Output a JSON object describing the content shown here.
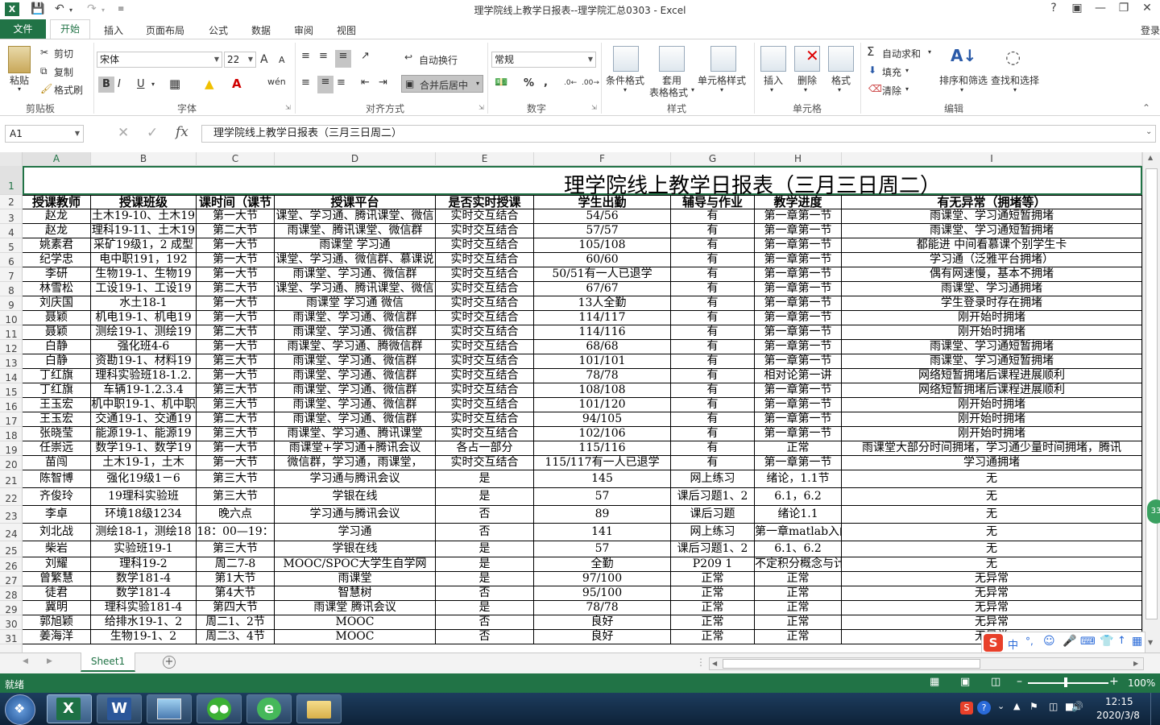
{
  "window": {
    "title": "理学院线上教学日报表--理学院汇总0303 - Excel"
  },
  "quick_access": {
    "save": "save-icon",
    "undo": "undo-icon",
    "redo": "redo-icon"
  },
  "window_controls": {
    "help": "?",
    "restore": "□",
    "minimize": "—",
    "maximize": "❐",
    "close": "✕"
  },
  "tabs": {
    "file": "文件",
    "home": "开始",
    "insert": "插入",
    "page_layout": "页面布局",
    "formulas": "公式",
    "data": "数据",
    "review": "审阅",
    "view": "视图",
    "login": "登录"
  },
  "ribbon": {
    "clipboard": {
      "paste": "粘贴",
      "cut": "剪切",
      "copy": "复制",
      "format_painter": "格式刷",
      "label": "剪贴板"
    },
    "font": {
      "name": "宋体",
      "size": "22",
      "grow": "A",
      "shrink": "A",
      "bold": "B",
      "italic": "I",
      "underline": "U",
      "label": "字体"
    },
    "alignment": {
      "wrap": "自动换行",
      "merge": "合并后居中",
      "label": "对齐方式"
    },
    "number": {
      "format": "常规",
      "percent": "%",
      "comma": ",",
      "label": "数字"
    },
    "styles": {
      "cond_format": "条件格式",
      "table_format_1": "套用",
      "table_format_2": "表格格式",
      "cell_styles": "单元格样式",
      "label": "样式"
    },
    "cells": {
      "insert": "插入",
      "delete": "删除",
      "format": "格式",
      "label": "单元格"
    },
    "editing": {
      "autosum": "自动求和",
      "fill": "填充",
      "clear": "清除",
      "sort": "排序和筛选",
      "find": "查找和选择",
      "label": "编辑"
    }
  },
  "formula_bar": {
    "cell_ref": "A1",
    "fx": "fx",
    "content": "理学院线上教学日报表（三月三日周二）"
  },
  "columns": [
    "A",
    "B",
    "C",
    "D",
    "E",
    "F",
    "G",
    "H",
    "I"
  ],
  "sheet_title": "理学院线上教学日报表（三月三日周二）",
  "headers": [
    "授课教师",
    "授课班级",
    "课时间（课节",
    "授课平台",
    "是否实时授课",
    "学生出勤",
    "辅导与作业",
    "教学进度",
    "有无异常（拥堵等）"
  ],
  "rows": [
    {
      "n": "3",
      "cells": [
        "赵龙",
        "土木19-10、土木19",
        "第一大节",
        "课堂、学习通、腾讯课堂、微信",
        "实时交互结合",
        "54/56",
        "有",
        "第一章第一节",
        "雨课堂、学习通短暂拥堵"
      ]
    },
    {
      "n": "4",
      "cells": [
        "赵龙",
        "理科19-11、土木19",
        "第二大节",
        "雨课堂、腾讯课堂、微信群",
        "实时交互结合",
        "57/57",
        "有",
        "第一章第一节",
        "雨课堂、学习通短暂拥堵"
      ]
    },
    {
      "n": "5",
      "cells": [
        "姚素君",
        "采矿19级1，2 成型",
        "第一大节",
        "雨课堂 学习通",
        "实时交互结合",
        "105/108",
        "有",
        "第一章第一节",
        "都能进 中间看慕课个别学生卡"
      ]
    },
    {
      "n": "6",
      "cells": [
        "纪学忠",
        "电中职191，192",
        "第一大节",
        "课堂、学习通、微信群、慕课说",
        "实时交互结合",
        "60/60",
        "有",
        "第一章第一节",
        "学习通（泛雅平台拥堵）"
      ]
    },
    {
      "n": "7",
      "cells": [
        "李研",
        "生物19-1、生物19",
        "第一大节",
        "雨课堂、学习通、微信群",
        "实时交互结合",
        "50/51有一人已退学",
        "有",
        "第一章第一节",
        "偶有网速慢，基本不拥堵"
      ]
    },
    {
      "n": "8",
      "cells": [
        "林雪松",
        "工设19-1、工设19",
        "第二大节",
        "课堂、学习通、腾讯课堂、微信",
        "实时交互结合",
        "67/67",
        "有",
        "第一章第一节",
        "雨课堂、学习通拥堵"
      ]
    },
    {
      "n": "9",
      "cells": [
        "刘庆国",
        "水土18-1",
        "第一大节",
        "雨课堂 学习通 微信",
        "实时交互结合",
        "13人全勤",
        "有",
        "第一章第一节",
        "学生登录时存在拥堵"
      ]
    },
    {
      "n": "10",
      "cells": [
        "聂颖",
        "机电19-1、机电19",
        "第一大节",
        "雨课堂、学习通、微信群",
        "实时交互结合",
        "114/117",
        "有",
        "第一章第一节",
        "刚开始时拥堵"
      ]
    },
    {
      "n": "11",
      "cells": [
        "聂颖",
        "测绘19-1、测绘19",
        "第二大节",
        "雨课堂、学习通、微信群",
        "实时交互结合",
        "114/116",
        "有",
        "第一章第一节",
        "刚开始时拥堵"
      ]
    },
    {
      "n": "12",
      "cells": [
        "白静",
        "强化班4-6",
        "第一大节",
        "雨课堂、学习通、腾微信群",
        "实时交互结合",
        "68/68",
        "有",
        "第一章第一节",
        "雨课堂、学习通短暂拥堵"
      ]
    },
    {
      "n": "13",
      "cells": [
        "白静",
        "资勘19-1、材料19",
        "第三大节",
        "雨课堂、学习通、微信群",
        "实时交互结合",
        "101/101",
        "有",
        "第一章第一节",
        "雨课堂、学习通短暂拥堵"
      ]
    },
    {
      "n": "14",
      "cells": [
        "丁红旗",
        "理科实验班18-1.2.",
        "第一大节",
        "雨课堂、学习通、微信群",
        "实时交互结合",
        "78/78",
        "有",
        "相对论第一讲",
        "网络短暂拥堵后课程进展顺利"
      ]
    },
    {
      "n": "15",
      "cells": [
        "丁红旗",
        "车辆19-1.2.3.4",
        "第三大节",
        "雨课堂、学习通、微信群",
        "实时交互结合",
        "108/108",
        "有",
        "第一章第一节",
        "网络短暂拥堵后课程进展顺利"
      ]
    },
    {
      "n": "16",
      "cells": [
        "王玉宏",
        "机中职19-1、机中职",
        "第三大节",
        "雨课堂、学习通、微信群",
        "实时交互结合",
        "101/120",
        "有",
        "第一章第一节",
        "刚开始时拥堵"
      ]
    },
    {
      "n": "17",
      "cells": [
        "王玉宏",
        "交通19-1、交通19",
        "第二大节",
        "雨课堂、学习通、微信群",
        "实时交互结合",
        "94/105",
        "有",
        "第一章第一节",
        "刚开始时拥堵"
      ]
    },
    {
      "n": "18",
      "cells": [
        "张晓莹",
        "能源19-1、能源19",
        "第三大节",
        "雨课堂、学习通、腾讯课堂",
        "实时交互结合",
        "102/106",
        "有",
        "第一章第一节",
        "刚开始时拥堵"
      ]
    },
    {
      "n": "19",
      "cells": [
        "任崇远",
        "数学19-1、数学19",
        "第一大节",
        "雨课堂+学习通+腾讯会议",
        "各占一部分",
        "115/116",
        "有",
        "正常",
        "雨课堂大部分时间拥堵，学习通少量时间拥堵，腾讯"
      ]
    },
    {
      "n": "20",
      "cells": [
        "苗闯",
        "土木19-1，土木",
        "第一大节",
        "微信群，学习通，雨课堂，",
        "实时交互结合",
        "115/117有一人已退学",
        "有",
        "第一章第一节",
        "学习通拥堵"
      ]
    },
    {
      "n": "21",
      "cells": [
        "陈智博",
        "强化19级1－6",
        "第三大节",
        "学习通与腾讯会议",
        "是",
        "145",
        "网上练习",
        "绪论，1.1节",
        "无"
      ]
    },
    {
      "n": "22",
      "cells": [
        "齐俊玲",
        "19理科实验班",
        "第三大节",
        "学银在线",
        "是",
        "57",
        "课后习题1、2",
        "6.1，6.2",
        "无"
      ]
    },
    {
      "n": "23",
      "cells": [
        "李卓",
        "环境18级1234",
        "晚六点",
        "学习通与腾讯会议",
        "否",
        "89",
        "课后习题",
        "绪论1.1",
        "无"
      ]
    },
    {
      "n": "24",
      "cells": [
        "刘北战",
        "测绘18-1，测绘18",
        "18：00—19：",
        "学习通",
        "否",
        "141",
        "网上练习",
        "第一章matlab入门",
        "无"
      ]
    },
    {
      "n": "25",
      "cells": [
        "柴岩",
        "实验班19-1",
        "第三大节",
        "学银在线",
        "是",
        "57",
        "课后习题1、2",
        "6.1、6.2",
        "无"
      ]
    },
    {
      "n": "26",
      "cells": [
        "刘耀",
        "理科19-2",
        "周二7-8",
        "MOOC/SPOC大学生自学网",
        "是",
        "全勤",
        "P209 1",
        "不定积分概念与计",
        "无"
      ]
    },
    {
      "n": "27",
      "cells": [
        "曾繁慧",
        "数学181-4",
        "第1大节",
        "雨课堂",
        "是",
        "97/100",
        "正常",
        "正常",
        "无异常"
      ]
    },
    {
      "n": "28",
      "cells": [
        "徒君",
        "数学181-4",
        "第4大节",
        "智慧树",
        "否",
        "95/100",
        "正常",
        "正常",
        "无异常"
      ]
    },
    {
      "n": "29",
      "cells": [
        "冀明",
        "理科实验181-4",
        "第四大节",
        "雨课堂 腾讯会议",
        "是",
        "78/78",
        "正常",
        "正常",
        "无异常"
      ]
    },
    {
      "n": "30",
      "cells": [
        "郭旭颖",
        "给排水19-1、2",
        "周二1、2节",
        "MOOC",
        "否",
        "良好",
        "正常",
        "正常",
        "无异常"
      ]
    },
    {
      "n": "31",
      "cells": [
        "姜海洋",
        "生物19-1、2",
        "周二3、4节",
        "MOOC",
        "否",
        "良好",
        "正常",
        "正常",
        "无异常"
      ]
    }
  ],
  "sheet_tab": "Sheet1",
  "status": {
    "text": "就绪",
    "zoom": "100%"
  },
  "taskbar": {
    "time": "12:15",
    "date": "2020/3/8"
  },
  "ime": {
    "lang": "中"
  }
}
